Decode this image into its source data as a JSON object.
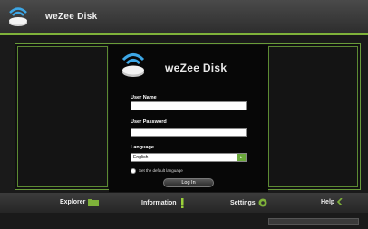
{
  "app": {
    "title": "weZee Disk"
  },
  "login": {
    "title": "weZee Disk",
    "user_name_label": "User Name",
    "user_name_value": "",
    "user_password_label": "User Password",
    "user_password_value": "",
    "language_label": "Language",
    "language_value": "English",
    "default_language_label": "Set the default language",
    "login_button": "Log In"
  },
  "nav": {
    "explorer": "Explorer",
    "information": "Information",
    "settings": "Settings",
    "help": "Help"
  },
  "colors": {
    "accent": "#7fb23a",
    "background": "#1a1a1a"
  }
}
